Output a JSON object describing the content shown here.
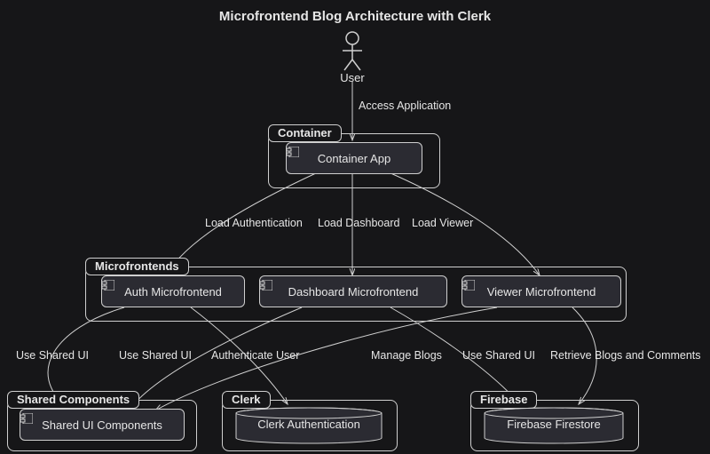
{
  "title": "Microfrontend Blog Architecture with Clerk",
  "actor": {
    "label": "User"
  },
  "edges": {
    "access": "Access Application",
    "loadAuth": "Load Authentication",
    "loadDash": "Load Dashboard",
    "loadViewer": "Load Viewer",
    "useShared1": "Use Shared UI",
    "useShared2": "Use Shared UI",
    "authUser": "Authenticate User",
    "manageBlogs": "Manage Blogs",
    "useShared3": "Use Shared UI",
    "retrieve": "Retrieve Blogs and Comments"
  },
  "groups": {
    "container": "Container",
    "microfrontends": "Microfrontends",
    "shared": "Shared Components",
    "clerk": "Clerk",
    "firebase": "Firebase"
  },
  "nodes": {
    "containerApp": "Container App",
    "authMF": "Auth Microfrontend",
    "dashMF": "Dashboard Microfrontend",
    "viewerMF": "Viewer Microfrontend",
    "sharedUI": "Shared UI Components",
    "clerkAuth": "Clerk Authentication",
    "firestore": "Firebase Firestore"
  }
}
